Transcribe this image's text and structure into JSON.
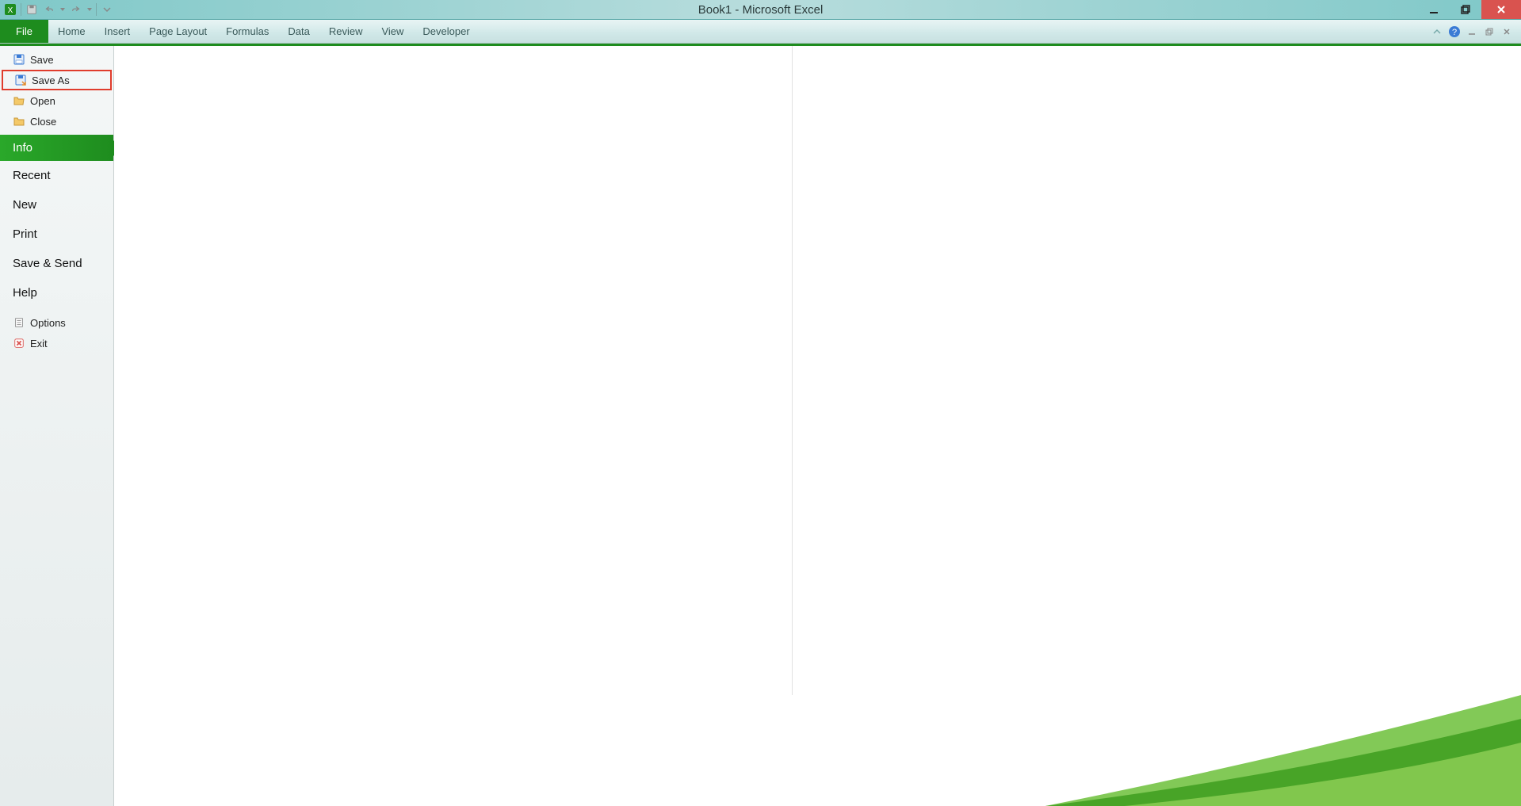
{
  "window": {
    "title": "Book1 - Microsoft Excel"
  },
  "ribbon": {
    "tabs": [
      "File",
      "Home",
      "Insert",
      "Page Layout",
      "Formulas",
      "Data",
      "Review",
      "View",
      "Developer"
    ],
    "active": "File"
  },
  "backstage": {
    "file_ops": [
      {
        "label": "Save",
        "icon": "save-icon"
      },
      {
        "label": "Save As",
        "icon": "saveas-icon",
        "highlighted": true
      },
      {
        "label": "Open",
        "icon": "folder-open-icon"
      },
      {
        "label": "Close",
        "icon": "folder-close-icon"
      }
    ],
    "selected": "Info",
    "nav": [
      "Recent",
      "New",
      "Print",
      "Save & Send",
      "Help"
    ],
    "bottom": [
      {
        "label": "Options",
        "icon": "options-icon"
      },
      {
        "label": "Exit",
        "icon": "exit-icon"
      }
    ]
  },
  "colors": {
    "accent_green": "#1e8c1e",
    "title_teal": "#7fc8c8",
    "close_red": "#d9534f",
    "highlight_red": "#e03c2c"
  }
}
